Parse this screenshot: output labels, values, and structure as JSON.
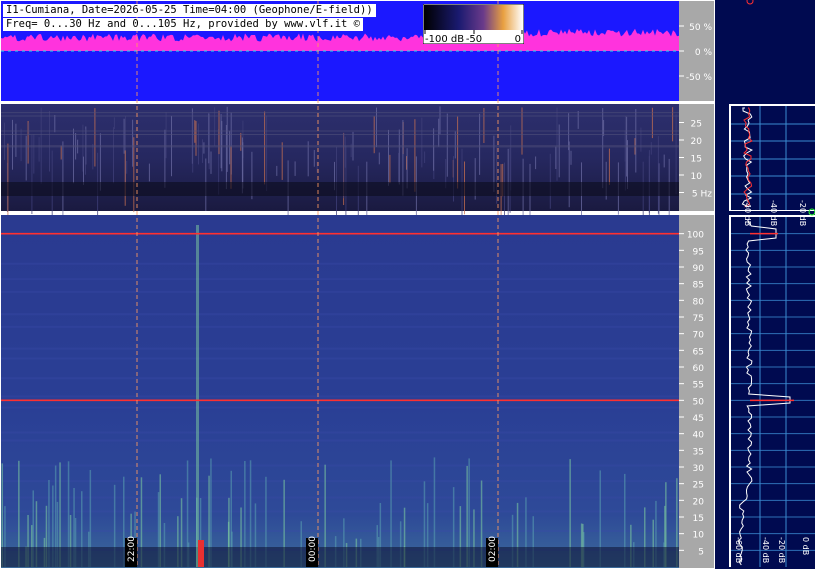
{
  "header": {
    "line1": "I1-Cumiana, Date=2026-05-25 Time=04:00 (Geophone/E-field))",
    "line2": "Freq= 0...30 Hz and 0...105 Hz, provided by www.vlf.it ©"
  },
  "colorbar": {
    "labels": [
      "-100 dB",
      "-50",
      "0"
    ]
  },
  "colors": {
    "amplitude_background": "#1b18ff",
    "amplitude_signal": "#ff33dd",
    "spectrogram_base": "#2a3a8c",
    "spectrum_panel": "#000a50",
    "mains_line": "#ff3030"
  },
  "chart_data": [
    {
      "type": "area",
      "role": "amplitude",
      "ylabels": [
        "50 %",
        "0 %",
        "-50 %"
      ],
      "yticks": [
        50,
        0,
        -50
      ],
      "ylim": [
        -100,
        100
      ]
    },
    {
      "type": "heatmap",
      "role": "spectrogram-low",
      "yunit_label": "5 Hz",
      "yticks": [
        25,
        20,
        15,
        10
      ],
      "ylim": [
        0,
        30
      ],
      "xlabels": [
        "22:00",
        "00:00",
        "02:00"
      ]
    },
    {
      "type": "heatmap",
      "role": "spectrogram-high",
      "yticks": [
        100,
        95,
        90,
        85,
        80,
        75,
        70,
        65,
        60,
        55,
        50,
        45,
        40,
        35,
        30,
        25,
        20,
        15,
        10,
        5
      ],
      "ylim": [
        0,
        105
      ],
      "xlabels": [
        "22:00",
        "00:00",
        "02:00"
      ],
      "mains_lines_hz": [
        50,
        100
      ]
    },
    {
      "type": "line",
      "role": "spectrum-low",
      "xlabels": [
        "-40 dB",
        "-40 dB",
        "-20 dB"
      ]
    },
    {
      "type": "line",
      "role": "spectrum-high",
      "xlabels": [
        "-60 dB",
        "-40 dB",
        "-20 dB",
        "0 dB"
      ],
      "peaks_hz": [
        50,
        100
      ]
    }
  ]
}
